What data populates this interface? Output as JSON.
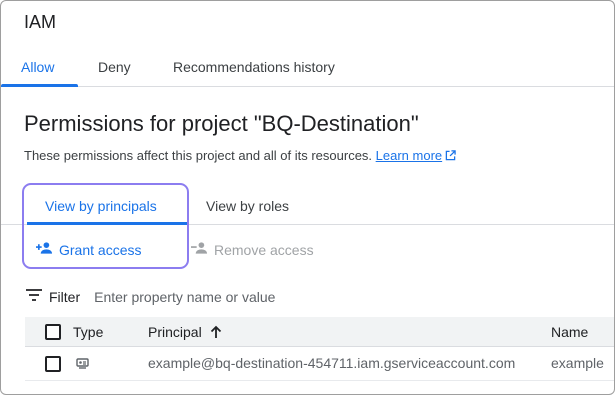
{
  "header": {
    "title": "IAM"
  },
  "tabs": [
    {
      "label": "Allow",
      "active": true
    },
    {
      "label": "Deny",
      "active": false
    },
    {
      "label": "Recommendations history",
      "active": false
    }
  ],
  "page": {
    "heading": "Permissions for project \"BQ-Destination\"",
    "description": "These permissions affect this project and all of its resources.",
    "learn_more": "Learn more"
  },
  "view_tabs": [
    {
      "label": "View by principals",
      "active": true
    },
    {
      "label": "View by roles",
      "active": false
    }
  ],
  "actions": {
    "grant": "Grant access",
    "remove": "Remove access"
  },
  "filter": {
    "label": "Filter",
    "placeholder": "Enter property name or value"
  },
  "table": {
    "columns": [
      "Type",
      "Principal",
      "Name"
    ],
    "sort_column": "Principal",
    "rows": [
      {
        "type_icon": "service-account-icon",
        "principal": "example@bq-destination-454711.iam.gserviceaccount.com",
        "name": "example"
      }
    ]
  },
  "colors": {
    "accent": "#1a73e8",
    "highlight": "#8c7df0",
    "disabled": "#a0a3a6"
  }
}
